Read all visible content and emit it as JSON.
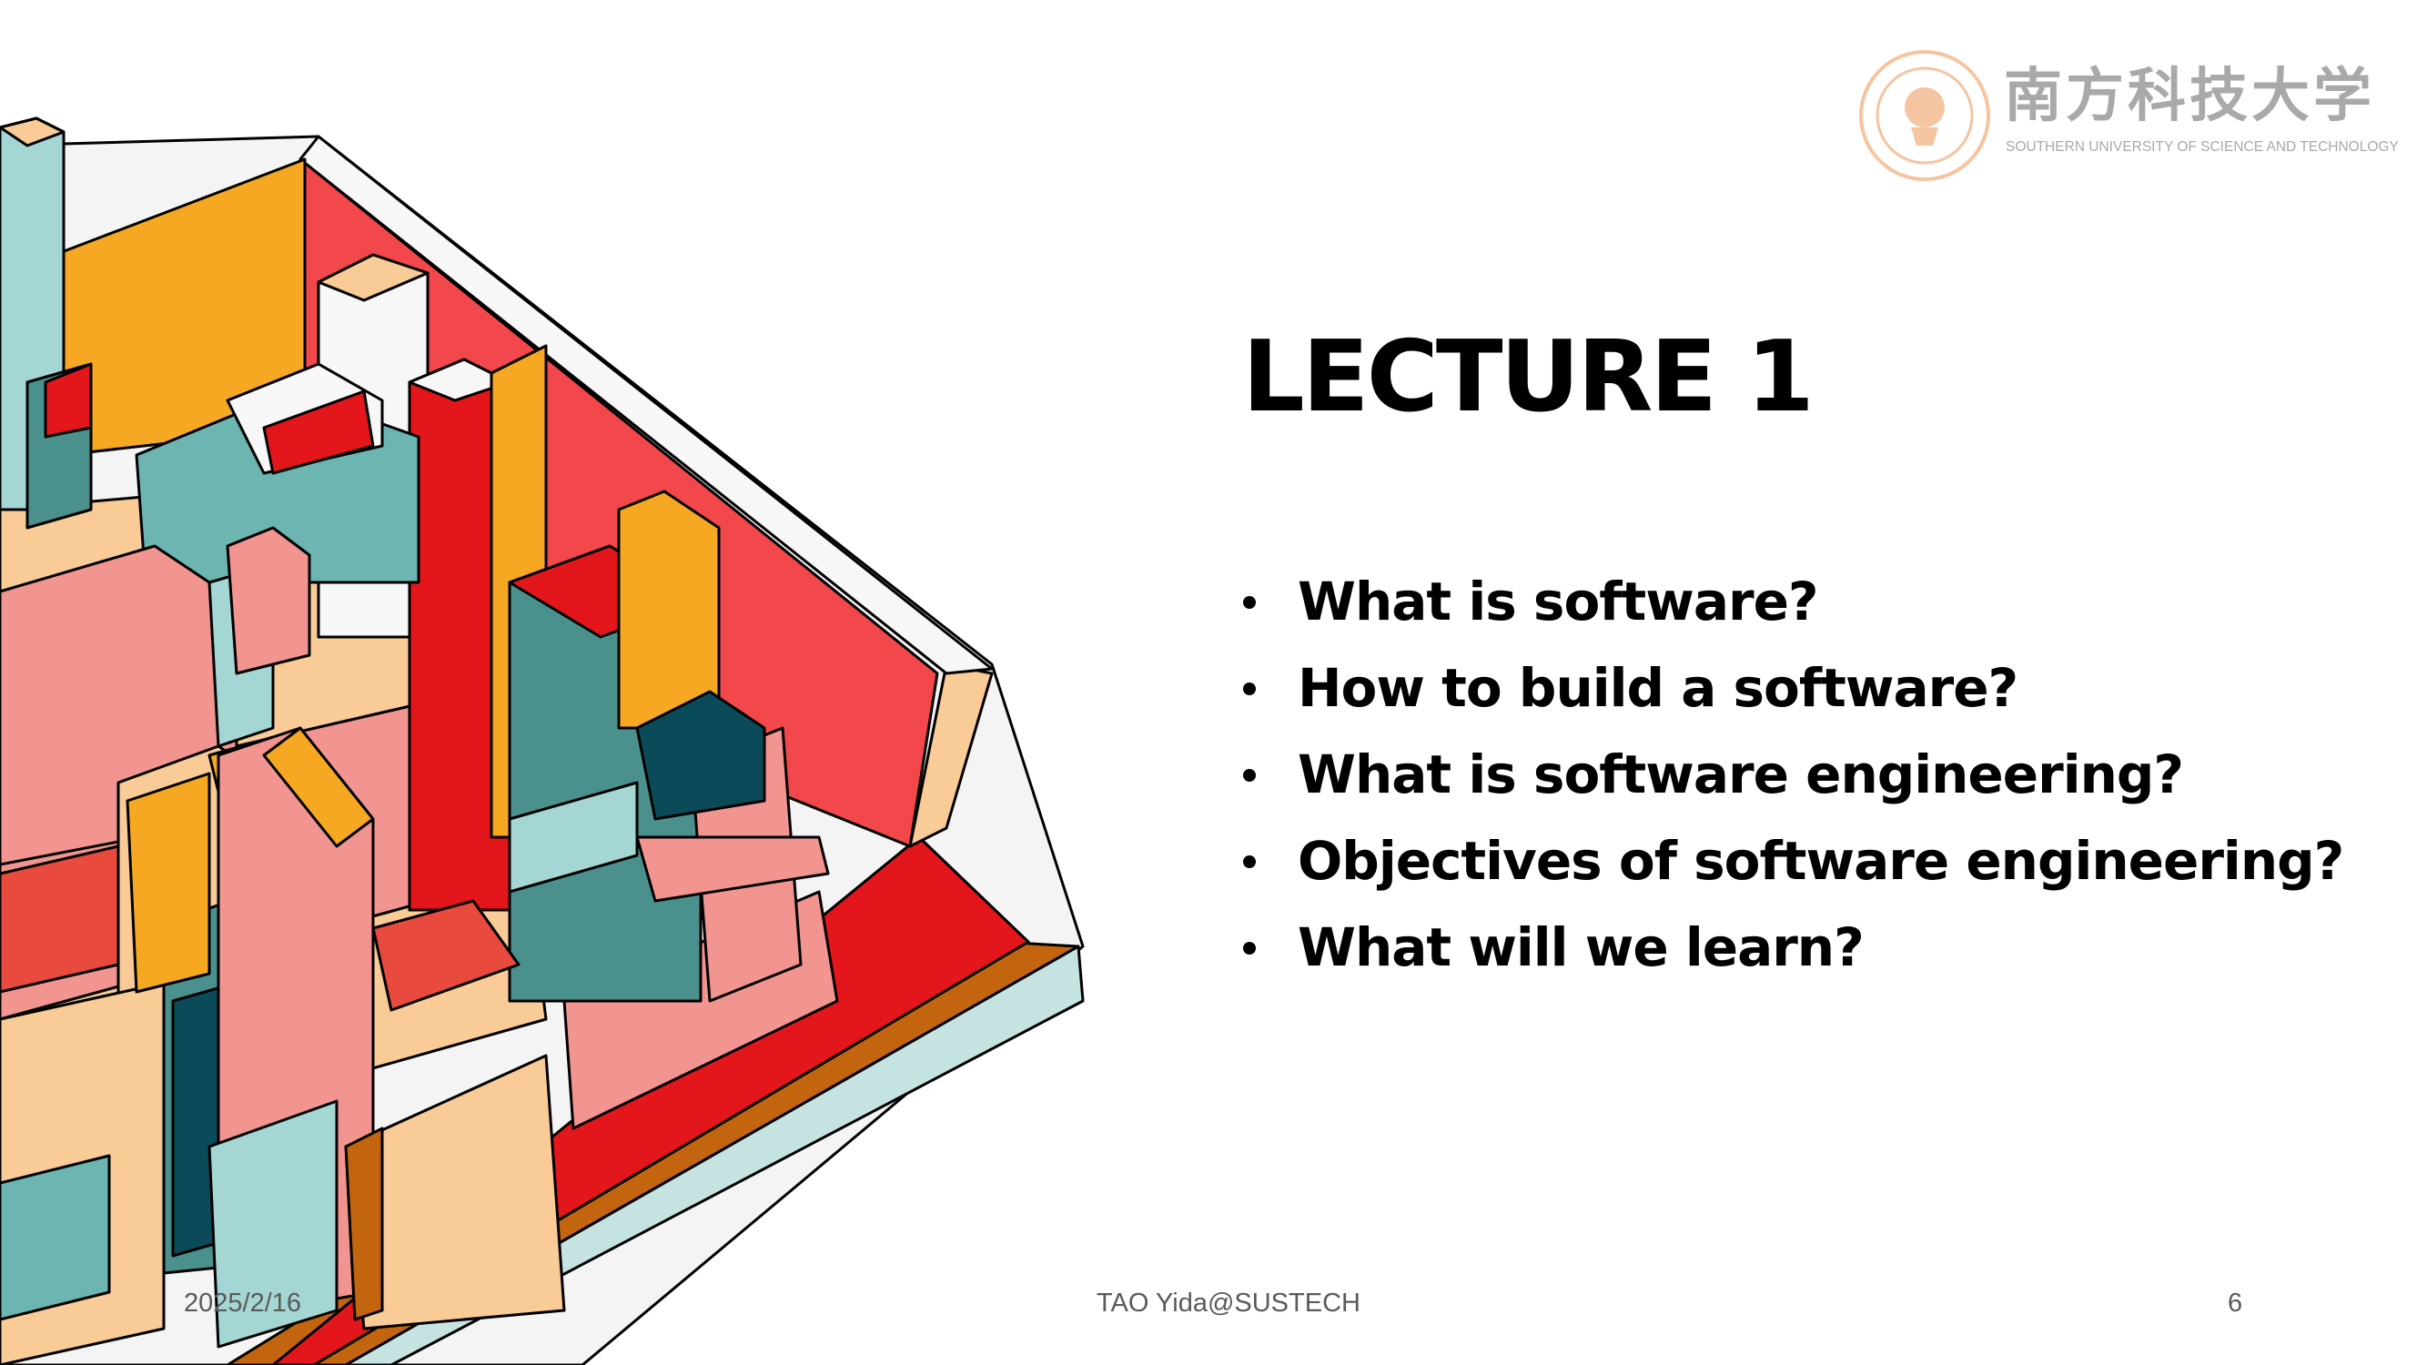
{
  "slide": {
    "title": "LECTURE 1",
    "bullets": [
      "What is software?",
      "How to build a software?",
      "What is software engineering?",
      "Objectives of software engineering?",
      "What will we learn?"
    ]
  },
  "logo": {
    "chinese_name": "南方科技大学",
    "english_name": "SOUTHERN UNIVERSITY OF SCIENCE AND TECHNOLOGY"
  },
  "footer": {
    "date": "2025/2/16",
    "author": "TAO Yida@SUSTECH",
    "page_number": "6"
  },
  "illustration": {
    "subject": "isometric-city-blocks",
    "colors": {
      "red": "#e3161b",
      "coral": "#f2484c",
      "salmon": "#f29590",
      "peach": "#f9cb97",
      "orange": "#f6a823",
      "teal": "#4a918d",
      "mint": "#a4d6d3",
      "navy": "#0b4a58",
      "brown": "#c2650e",
      "white": "#f7f7f7"
    }
  }
}
